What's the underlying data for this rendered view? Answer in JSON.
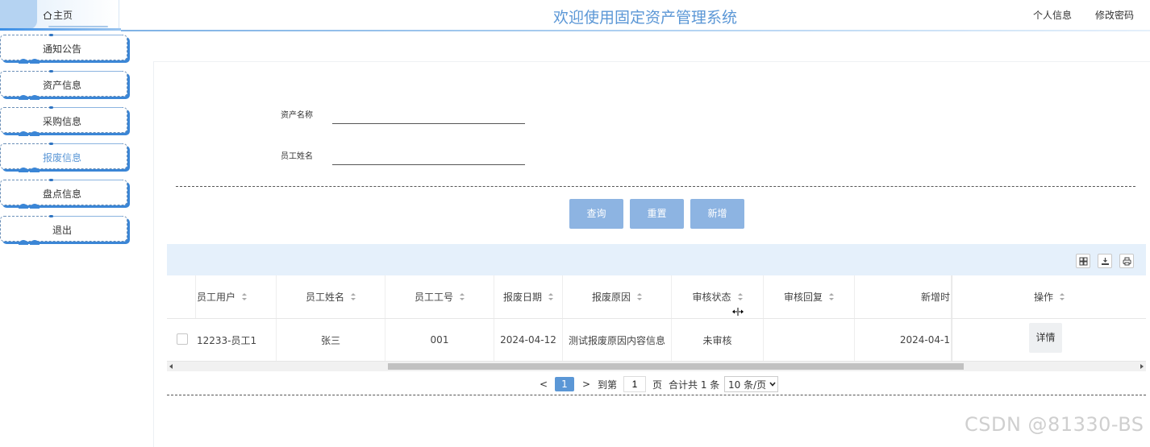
{
  "header": {
    "home_label": "主页",
    "title": "欢迎使用固定资产管理系统",
    "links": [
      "个人信息",
      "修改密码"
    ]
  },
  "sidebar": {
    "items": [
      {
        "label": "通知公告",
        "active": false
      },
      {
        "label": "资产信息",
        "active": false
      },
      {
        "label": "采购信息",
        "active": false
      },
      {
        "label": "报废信息",
        "active": true
      },
      {
        "label": "盘点信息",
        "active": false
      },
      {
        "label": "退出",
        "active": false
      }
    ]
  },
  "search": {
    "asset_name_label": "资产名称",
    "asset_name_value": "",
    "employee_name_label": "员工姓名",
    "employee_name_value": ""
  },
  "buttons": {
    "query": "查询",
    "reset": "重置",
    "add": "新增"
  },
  "table": {
    "columns": [
      "员工用户",
      "员工姓名",
      "员工工号",
      "报废日期",
      "报废原因",
      "审核状态",
      "审核回复",
      "新增时",
      "操作"
    ],
    "rows": [
      {
        "employee_user": "12233-员工1",
        "employee_name": "张三",
        "employee_no": "001",
        "scrap_date": "2024-04-12",
        "scrap_reason": "测试报废原因内容信息",
        "review_status": "未审核",
        "review_reply": "",
        "created": "2024-04-1",
        "action": "详情"
      }
    ]
  },
  "pagination": {
    "prev": "<",
    "current_page": "1",
    "next": ">",
    "goto_label": "到第",
    "goto_value": "1",
    "page_unit": "页",
    "total": "合计共 1 条",
    "page_size": "10 条/页"
  },
  "watermark": "CSDN @81330-BS",
  "colors": {
    "accent": "#5b97d6",
    "button": "#8db4e2",
    "sidebar_shadow": "#3b86d6",
    "toolbar_bg": "#e5f0fb"
  }
}
